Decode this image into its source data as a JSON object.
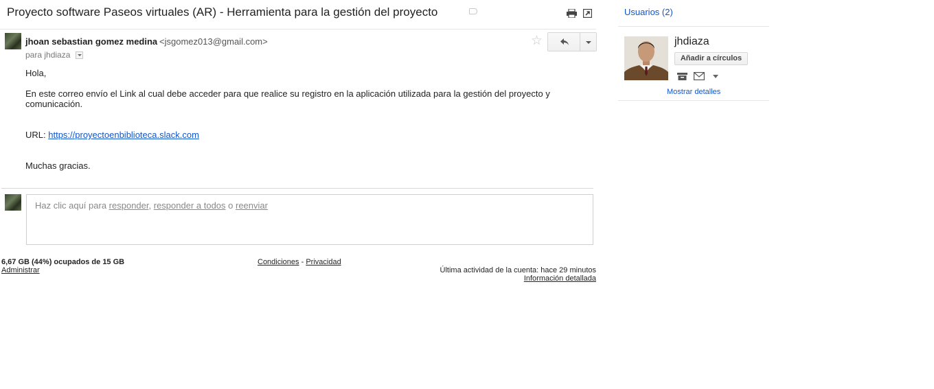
{
  "thread": {
    "subject": "Proyecto software Paseos virtuales (AR) - Herramienta para la gestión del proyecto"
  },
  "message": {
    "sender_name": "jhoan sebastian gomez medina",
    "sender_email": "<jsgomez013@gmail.com>",
    "recipient_line": "para jhdiaza",
    "body": {
      "greeting": "Hola,",
      "para1_line1": "En este correo envío el Link al cual debe acceder para que realice su registro en la aplicación utilizada para la gestión del proyecto y",
      "para1_line2": "comunicación.",
      "url_label": "URL: ",
      "url": "https://proyectoenbiblioteca.slack.com",
      "closing": "Muchas gracias."
    }
  },
  "reply_box": {
    "prefix": "Haz clic aquí para ",
    "reply": "responder",
    "sep": ", ",
    "reply_all": "responder a todos",
    "or": " o ",
    "forward": "reenviar"
  },
  "footer": {
    "storage": "6,67 GB (44%) ocupados de 15 GB",
    "manage": "Administrar",
    "terms": "Condiciones",
    "dash": " - ",
    "privacy": "Privacidad",
    "last_activity": "Última actividad de la cuenta: hace 29 minutos",
    "details": "Información detallada"
  },
  "sidebar": {
    "users_title": "Usuarios (2)",
    "contact_name": "jhdiaza",
    "add_circles": "Añadir a círculos",
    "show_details": "Mostrar detalles"
  },
  "icons": {
    "print": "print-icon",
    "new_window": "new-window-icon",
    "star": "star-icon",
    "reply": "reply-arrow-icon",
    "more": "chevron-down-icon",
    "label": "label-tag-icon",
    "contact_card": "contact-card-icon",
    "mail": "mail-icon"
  },
  "colors": {
    "link": "#1155cc",
    "text": "#222222",
    "muted": "#777777"
  }
}
